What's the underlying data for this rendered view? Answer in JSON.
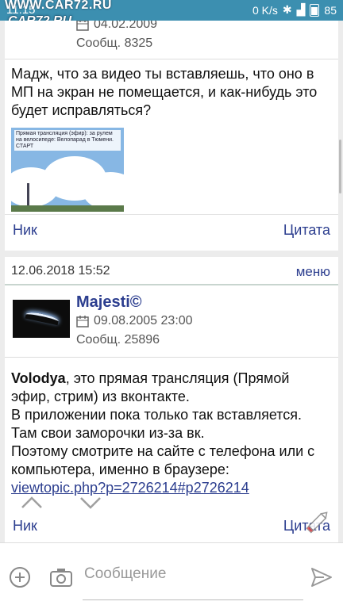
{
  "status": {
    "time": "11:15",
    "network_speed": "0 K/s",
    "battery": "85",
    "watermark": "WWW.CAR72.RU"
  },
  "site": {
    "logo_text": "CAR72.RU"
  },
  "post1": {
    "date": "04.02.2009",
    "post_count": "Сообщ. 8325",
    "text": "Мадж, что за видео ты вставляешь, что оно в МП на экран не помещается, и как-нибудь это будет исправляться?",
    "thumbnail_caption": "Прямая трансляция (эфир): за рулем на велосипеде: Велопарад в Тюмени. СТАРТ",
    "nick_link": "Ник",
    "quote_link": "Цитата"
  },
  "post2": {
    "timestamp": "12.06.2018 15:52",
    "menu_label": "меню",
    "username": "Majesti©",
    "reg_date": "09.08.2005 23:00",
    "post_count": "Сообщ. 25896",
    "mention": "Volodya",
    "text_after_mention": ", это прямая трансляция (Прямой эфир, стрим) из вконтакте.",
    "line2": "В приложении пока только так вставляется.",
    "line3": "Там свои заморочки из-за вк.",
    "line4": "Поэтому смотрите на сайте с телефона или с компьютера, именно в браузере:",
    "link": "viewtopic.php?p=2726214#p2726214",
    "nick_link": "Ник",
    "quote_link": "Цитата"
  },
  "composer": {
    "placeholder": "Сообщение"
  },
  "icons": {
    "calendar": "calendar-icon",
    "attach": "add-circle-icon",
    "camera": "camera-icon",
    "send": "send-icon",
    "up": "chevron-up-icon",
    "down": "chevron-down-icon",
    "pencil": "pencil-icon"
  },
  "colors": {
    "status_bar": "#3c8fb0",
    "link": "#2c3e8f",
    "background": "#ececec"
  }
}
